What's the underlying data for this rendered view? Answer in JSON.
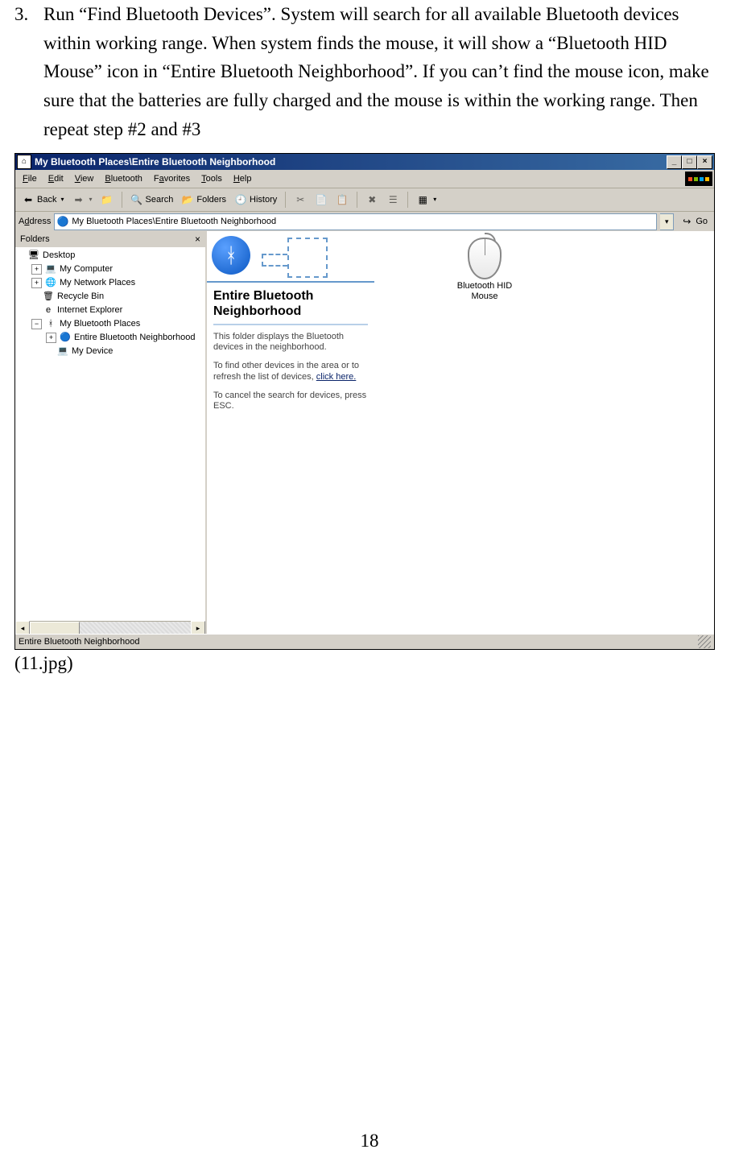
{
  "instruction": {
    "number": "3.",
    "text": "Run “Find Bluetooth Devices”. System will search for all available Bluetooth devices within working range. When system finds the mouse, it will show a “Bluetooth HID Mouse” icon in “Entire Bluetooth Neighborhood”. If you can’t find the mouse icon, make sure that the batteries are fully charged and the mouse is within the working range. Then repeat step #2 and #3"
  },
  "caption": "(11.jpg)",
  "pageNumber": "18",
  "window": {
    "title": "My Bluetooth Places\\Entire Bluetooth Neighborhood",
    "controls": {
      "min": "_",
      "max": "□",
      "close": "×"
    }
  },
  "menu": [
    "File",
    "Edit",
    "View",
    "Bluetooth",
    "Favorites",
    "Tools",
    "Help"
  ],
  "toolbar": {
    "back": "Back",
    "search": "Search",
    "folders": "Folders",
    "history": "History"
  },
  "address": {
    "label": "Address",
    "value": "My Bluetooth Places\\Entire Bluetooth Neighborhood",
    "go": "Go"
  },
  "foldersPanel": {
    "title": "Folders",
    "items": [
      {
        "indent": 0,
        "exp": "",
        "icon": "🖥",
        "label": "Desktop"
      },
      {
        "indent": 1,
        "exp": "+",
        "icon": "💻",
        "label": "My Computer"
      },
      {
        "indent": 1,
        "exp": "+",
        "icon": "🌐",
        "label": "My Network Places"
      },
      {
        "indent": 1,
        "exp": "",
        "icon": "🗑",
        "label": "Recycle Bin"
      },
      {
        "indent": 1,
        "exp": "",
        "icon": "e",
        "label": "Internet Explorer"
      },
      {
        "indent": 1,
        "exp": "−",
        "icon": "ᚼ",
        "label": "My Bluetooth Places"
      },
      {
        "indent": 2,
        "exp": "+",
        "icon": "🔵",
        "label": "Entire Bluetooth Neighborhood"
      },
      {
        "indent": 2,
        "exp": "",
        "icon": "💻",
        "label": "My Device"
      }
    ]
  },
  "info": {
    "title": "Entire Bluetooth Neighborhood",
    "p1": "This folder displays the Bluetooth devices in the neighborhood.",
    "p2a": "To find other devices in the area or to refresh the list of devices, ",
    "p2link": "click here.",
    "p3": "To cancel the search for devices, press ESC."
  },
  "device": {
    "label": "Bluetooth HID Mouse"
  },
  "status": "Entire Bluetooth Neighborhood"
}
